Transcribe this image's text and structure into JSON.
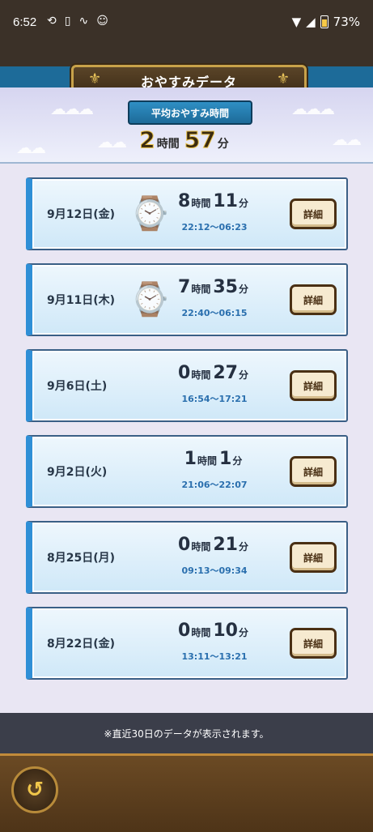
{
  "status_bar": {
    "time": "6:52",
    "battery": "73%",
    "icons": [
      "sync-icon",
      "phone-icon",
      "signal-icon",
      "app-icon",
      "wifi-icon",
      "cell-icon",
      "battery-icon"
    ]
  },
  "header": {
    "title": "おやすみデータ"
  },
  "summary": {
    "label": "平均おやすみ時間",
    "hours": "2",
    "hours_unit": "時間",
    "minutes": "57",
    "minutes_unit": "分"
  },
  "entries": [
    {
      "date": "9月12日(金)",
      "hours": "8",
      "minutes": "11",
      "range": "22:12～06:23",
      "detail_label": "詳細",
      "watch": true
    },
    {
      "date": "9月11日(木)",
      "hours": "7",
      "minutes": "35",
      "range": "22:40～06:15",
      "detail_label": "詳細",
      "watch": true
    },
    {
      "date": "9月6日(土)",
      "hours": "0",
      "minutes": "27",
      "range": "16:54～17:21",
      "detail_label": "詳細",
      "watch": false
    },
    {
      "date": "9月2日(火)",
      "hours": "1",
      "minutes": "1",
      "range": "21:06～22:07",
      "detail_label": "詳細",
      "watch": false
    },
    {
      "date": "8月25日(月)",
      "hours": "0",
      "minutes": "21",
      "range": "09:13～09:34",
      "detail_label": "詳細",
      "watch": false
    },
    {
      "date": "8月22日(金)",
      "hours": "0",
      "minutes": "10",
      "range": "13:11～13:21",
      "detail_label": "詳細",
      "watch": false
    }
  ],
  "units": {
    "hours": "時間",
    "minutes": "分"
  },
  "footer": {
    "note": "※直近30日のデータが表示されます。"
  },
  "colors": {
    "accent": "#2f8fd6",
    "header_band": "#1d6b99",
    "gold": "#c8a24a"
  }
}
